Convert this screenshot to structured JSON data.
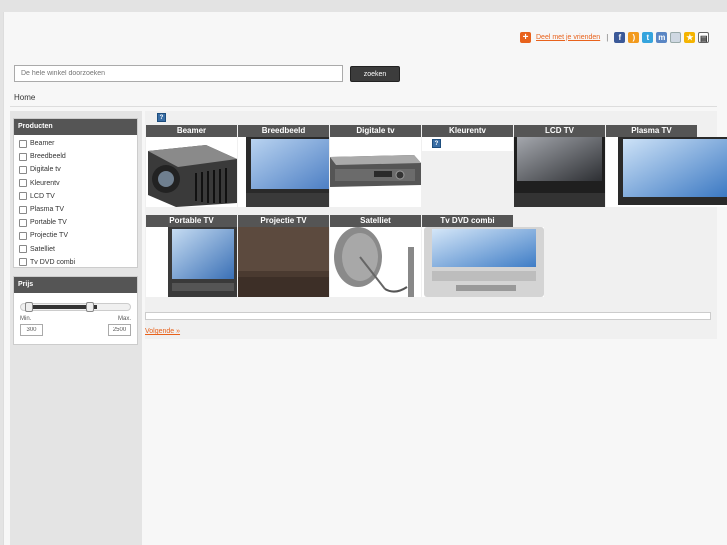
{
  "share": {
    "label": "Deel met je vrienden",
    "separator": "|",
    "icons": [
      "facebook-icon",
      "rss-icon",
      "twitter-icon",
      "myspace-icon",
      "email-icon",
      "favorite-icon",
      "print-icon"
    ]
  },
  "search": {
    "placeholder": "De hele winkel doorzoeken",
    "button": "zoeken"
  },
  "breadcrumb": "Home",
  "sidebar": {
    "products_title": "Producten",
    "categories": [
      "Beamer",
      "Breedbeeld",
      "Digitale tv",
      "Kleurentv",
      "LCD TV",
      "Plasma TV",
      "Portable TV",
      "Projectie TV",
      "Satelliet",
      "Tv DVD combi"
    ],
    "price_title": "Prijs",
    "min_label": "Min.",
    "max_label": "Max.",
    "min_value": "300",
    "max_value": "2500"
  },
  "grid": {
    "row1": [
      "Beamer",
      "Breedbeeld",
      "Digitale tv",
      "Kleurentv",
      "LCD TV",
      "Plasma TV"
    ],
    "row2": [
      "Portable TV",
      "Projectie TV",
      "Satelliet",
      "Tv DVD combi"
    ]
  },
  "pager": {
    "next": "Volgende »"
  },
  "colors": {
    "accent": "#e8621c",
    "header": "#555555"
  }
}
